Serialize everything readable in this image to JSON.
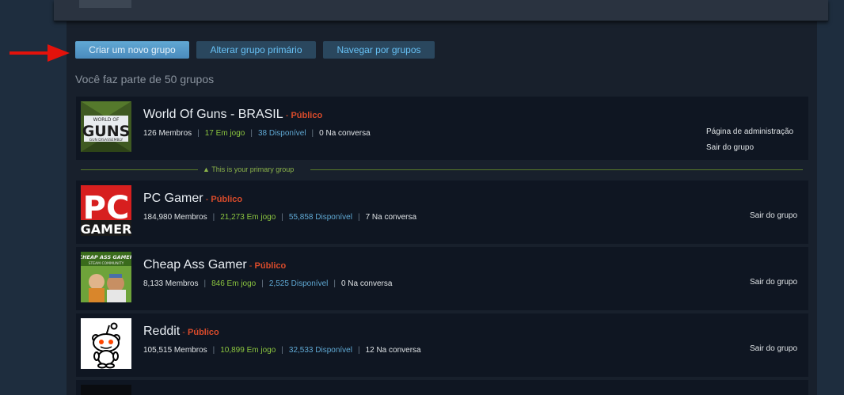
{
  "toolbar": {
    "create_label": "Criar um novo grupo",
    "change_primary_label": "Alterar grupo primário",
    "browse_label": "Navegar por grupos"
  },
  "groups_count_text": "Você faz parte de 50 grupos",
  "primary_group_label": "▲ This is your primary group",
  "groups": [
    {
      "name": "World Of Guns - BRASIL",
      "visibility": "Público",
      "members": "126 Membros",
      "in_game": "17 Em jogo",
      "online": "38 Disponível",
      "in_chat": "0 Na conversa",
      "admin_link": "Página de administração",
      "leave_link": "Sair do grupo",
      "avatar_text_top": "WORLD OF",
      "avatar_text_main": "GUNS",
      "avatar_text_bottom": "GUN DISASSEMBLY"
    },
    {
      "name": "PC Gamer",
      "visibility": "Público",
      "members": "184,980 Membros",
      "in_game": "21,273 Em jogo",
      "online": "55,858 Disponível",
      "in_chat": "7 Na conversa",
      "leave_link": "Sair do grupo",
      "avatar_text_top": "PC",
      "avatar_text_main": "GAMER"
    },
    {
      "name": "Cheap Ass Gamer",
      "visibility": "Público",
      "members": "8,133 Membros",
      "in_game": "846 Em jogo",
      "online": "2,525 Disponível",
      "in_chat": "0 Na conversa",
      "leave_link": "Sair do grupo",
      "avatar_text_top": "CHEAP ASS GAMER",
      "avatar_text_main": "STEAM COMMUNITY"
    },
    {
      "name": "Reddit",
      "visibility": "Público",
      "members": "105,515 Membros",
      "in_game": "10,899 Em jogo",
      "online": "32,533 Disponível",
      "in_chat": "12 Na conversa",
      "leave_link": "Sair do grupo"
    }
  ]
}
